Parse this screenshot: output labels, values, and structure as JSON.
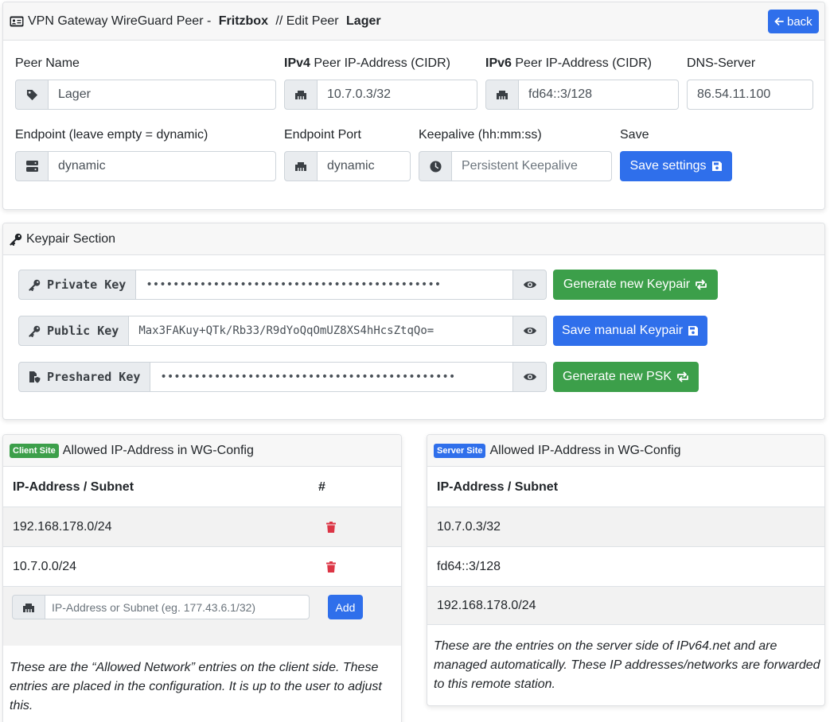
{
  "header": {
    "title_prefix": "VPN Gateway WireGuard Peer - ",
    "title_device": "Fritzbox",
    "title_middle": " // Edit Peer ",
    "title_peer": "Lager",
    "back_label": "back"
  },
  "peer": {
    "name_label": "Peer Name",
    "name_value": "Lager",
    "ipv4_label_bold": "IPv4",
    "ipv4_label_rest": " Peer IP-Address (CIDR)",
    "ipv4_value": "10.7.0.3/32",
    "ipv6_label_bold": "IPv6",
    "ipv6_label_rest": " Peer IP-Address (CIDR)",
    "ipv6_value": "fd64::3/128",
    "dns_label": "DNS-Server",
    "dns_value": "86.54.11.100",
    "endpoint_label": "Endpoint (leave empty = dynamic)",
    "endpoint_value": "dynamic",
    "port_label": "Endpoint Port",
    "port_value": "dynamic",
    "keepalive_label": "Keepalive (hh:mm:ss)",
    "keepalive_placeholder": "Persistent Keepalive",
    "save_label": "Save",
    "save_button": "Save settings"
  },
  "keypair": {
    "title": "Keypair Section",
    "private_label": "Private Key",
    "private_value": "••••••••••••••••••••••••••••••••••••••••••••",
    "public_label": "Public Key",
    "public_value": "Max3FAKuy+QTk/Rb33/R9dYoQqOmUZ8XS4hHcsZtqQo=",
    "psk_label": "Preshared Key",
    "psk_value": "••••••••••••••••••••••••••••••••••••••••••••",
    "generate_keypair": "Generate new Keypair",
    "save_manual": "Save manual Keypair",
    "generate_psk": "Generate new PSK"
  },
  "client_site": {
    "badge": "Client Site",
    "title": "Allowed IP-Address in WG-Config",
    "col_ip": "IP-Address / Subnet",
    "col_action": "#",
    "rows": [
      "192.168.178.0/24",
      "10.7.0.0/24"
    ],
    "input_placeholder": "IP-Address or Subnet (eg. 177.43.6.1/32)",
    "add_button": "Add",
    "note": "These are the “Allowed Network” entries on the client side. These entries are placed in the configuration. It is up to the user to adjust this."
  },
  "server_site": {
    "badge": "Server Site",
    "title": "Allowed IP-Address in WG-Config",
    "col_ip": "IP-Address / Subnet",
    "rows": [
      "10.7.0.3/32",
      "fd64::3/128",
      "192.168.178.0/24"
    ],
    "note": "These are the entries on the server side of IPv64.net and are managed automatically. These IP addresses/networks are forwarded to this remote station."
  },
  "colors": {
    "primary": "#2f6feb",
    "success": "#3c9f4a",
    "danger": "#dc3545"
  }
}
